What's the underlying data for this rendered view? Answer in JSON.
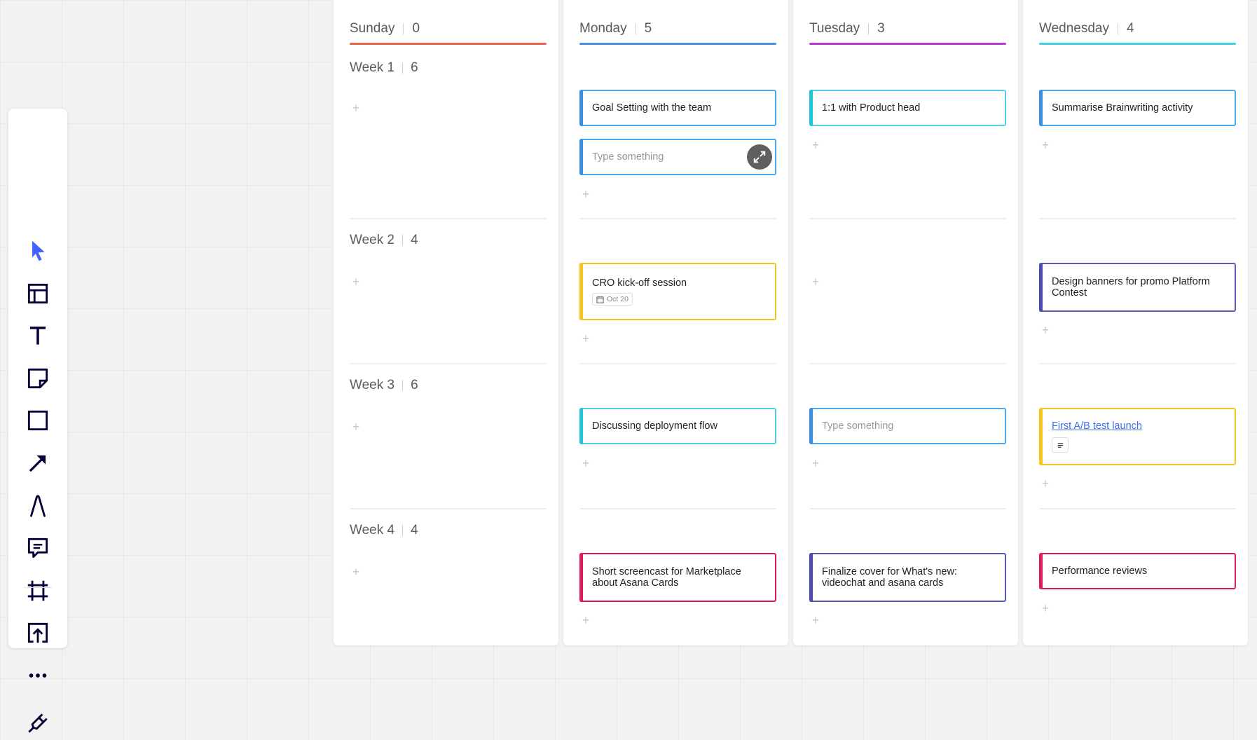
{
  "toolbar": {
    "tools": [
      {
        "name": "select-tool-icon"
      },
      {
        "name": "templates-icon"
      },
      {
        "name": "text-tool-icon"
      },
      {
        "name": "sticky-note-icon"
      },
      {
        "name": "shape-tool-icon"
      },
      {
        "name": "arrow-tool-icon"
      },
      {
        "name": "pen-tool-icon"
      },
      {
        "name": "comment-icon"
      },
      {
        "name": "frame-icon"
      },
      {
        "name": "upload-icon"
      },
      {
        "name": "more-icon"
      },
      {
        "name": "plugin-icon"
      }
    ],
    "accent": "#4262ff"
  },
  "columns": [
    {
      "name": "Sunday",
      "count": "0",
      "color": "#f0624d"
    },
    {
      "name": "Monday",
      "count": "5",
      "color": "#4a8fe7"
    },
    {
      "name": "Tuesday",
      "count": "3",
      "color": "#b63bd6"
    },
    {
      "name": "Wednesday",
      "count": "4",
      "color": "#3fd3d8"
    }
  ],
  "weeks": [
    {
      "label": "Week 1",
      "count": "6"
    },
    {
      "label": "Week 2",
      "count": "4"
    },
    {
      "label": "Week 3",
      "count": "6"
    },
    {
      "label": "Week 4",
      "count": "4"
    }
  ],
  "cards": {
    "mon_w1_a": {
      "text": "Goal Setting with the team",
      "color": "#3c8de8"
    },
    "mon_w1_b": {
      "text": "Type something",
      "color": "#3c8de8"
    },
    "tue_w1": {
      "text": "1:1 with Product head",
      "color": "#1ec7d9"
    },
    "wed_w1": {
      "text": "Summarise Brainwriting activity",
      "color": "#3c8de8"
    },
    "mon_w2": {
      "text": "CRO kick-off session",
      "date": "Oct 20",
      "color": "#f5c518"
    },
    "wed_w2": {
      "text": "Design banners for promo Platform Contest",
      "color": "#4b4bb0"
    },
    "mon_w3": {
      "text": "Discussing deployment flow",
      "color": "#1ec7d9"
    },
    "tue_w3": {
      "text": "Type something",
      "color": "#3c8de8"
    },
    "wed_w3": {
      "text": "First A/B test launch",
      "color": "#f5c518"
    },
    "mon_w4": {
      "text": "Short screencast for Marketplace about Asana Cards",
      "color": "#e0185f"
    },
    "tue_w4": {
      "text": "Finalize cover for What's new: videochat and asana cards",
      "color": "#4b4bb0"
    },
    "wed_w4": {
      "text": "Performance reviews",
      "color": "#e0185f"
    }
  }
}
